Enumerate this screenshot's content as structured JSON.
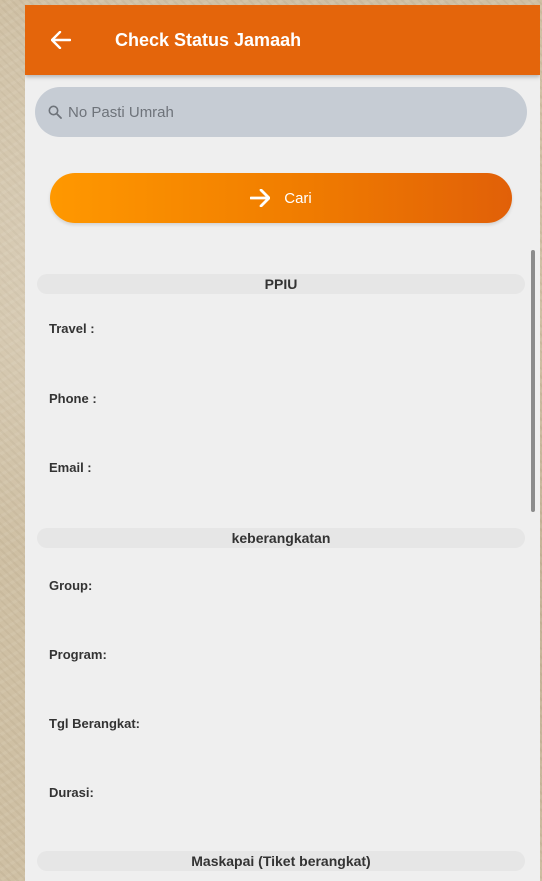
{
  "appbar": {
    "back_icon": "arrow-left-icon",
    "title": "Check Status Jamaah",
    "color": "#e4650b"
  },
  "search": {
    "icon": "search-icon",
    "placeholder": "No Pasti Umrah",
    "value": ""
  },
  "cari_button": {
    "icon": "arrow-right-icon",
    "label": "Cari"
  },
  "sections": {
    "ppiu": {
      "header": "PPIU",
      "travel": "Travel :",
      "phone": "Phone :",
      "email": "Email :"
    },
    "keberangkatan": {
      "header": "keberangkatan",
      "group": "Group:",
      "program": "Program:",
      "tgl_berangkat": "Tgl Berangkat:",
      "durasi": "Durasi:"
    },
    "maskapai": {
      "header": "Maskapai (Tiket berangkat)"
    }
  }
}
